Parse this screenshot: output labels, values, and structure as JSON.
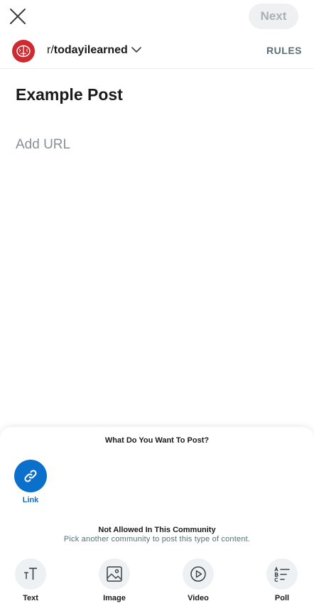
{
  "header": {
    "close_icon": "close-icon",
    "next_label": "Next"
  },
  "community": {
    "prefix": "r/",
    "name": "todayilearned",
    "avatar_icon": "brain-icon",
    "avatar_color": "#cd2a32",
    "rules_label": "RULES"
  },
  "post": {
    "title": "Example Post",
    "url_value": "",
    "url_placeholder": "Add URL"
  },
  "sheet": {
    "title": "What Do You Want To Post?",
    "selected": {
      "label": "Link",
      "icon": "link-icon",
      "color": "#0b6fcc"
    },
    "not_allowed_title": "Not Allowed In This Community",
    "not_allowed_subtitle": "Pick another community to post this type of content.",
    "options": [
      {
        "label": "Text",
        "icon": "text-icon"
      },
      {
        "label": "Image",
        "icon": "image-icon"
      },
      {
        "label": "Video",
        "icon": "video-icon"
      },
      {
        "label": "Poll",
        "icon": "poll-icon"
      }
    ]
  }
}
